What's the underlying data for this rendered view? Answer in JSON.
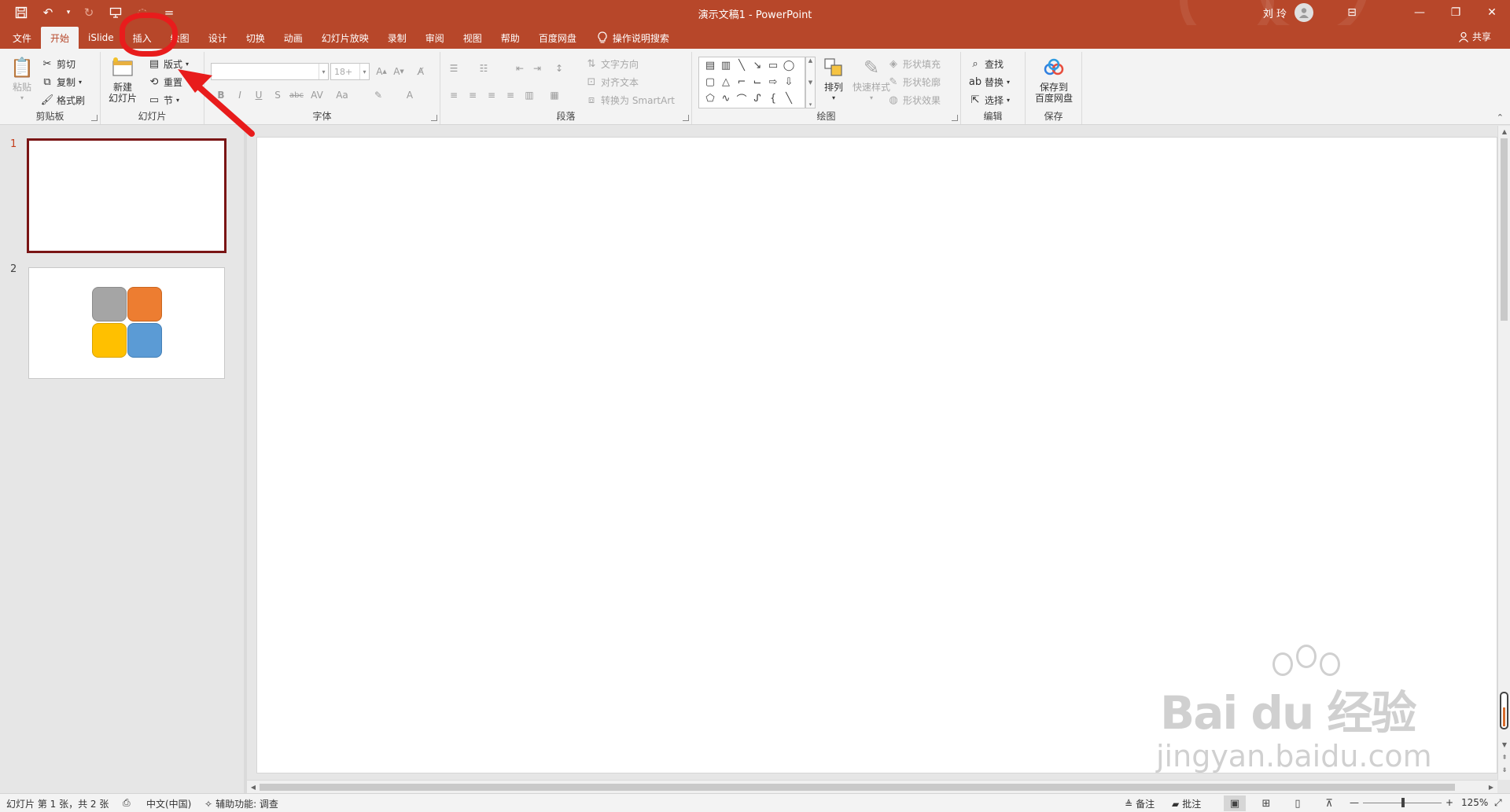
{
  "window": {
    "title": "演示文稿1  -  PowerPoint",
    "user_name": "刘 玲",
    "controls": [
      "minimize",
      "restore",
      "close"
    ]
  },
  "qat": [
    {
      "name": "save-icon",
      "glyph": "💾"
    },
    {
      "name": "undo-icon",
      "glyph": "↶"
    },
    {
      "name": "redo-icon",
      "glyph": "↻"
    },
    {
      "name": "present-icon",
      "glyph": "▭"
    },
    {
      "name": "customize-icon",
      "glyph": "="
    }
  ],
  "tabs": [
    {
      "label": "文件",
      "active": false
    },
    {
      "label": "开始",
      "active": true
    },
    {
      "label": "iSlide",
      "active": false
    },
    {
      "label": "插入",
      "active": false
    },
    {
      "label": "绘图",
      "active": false
    },
    {
      "label": "设计",
      "active": false
    },
    {
      "label": "切换",
      "active": false
    },
    {
      "label": "动画",
      "active": false
    },
    {
      "label": "幻灯片放映",
      "active": false
    },
    {
      "label": "录制",
      "active": false
    },
    {
      "label": "审阅",
      "active": false
    },
    {
      "label": "视图",
      "active": false
    },
    {
      "label": "帮助",
      "active": false
    },
    {
      "label": "百度网盘",
      "active": false
    }
  ],
  "tell_me": "操作说明搜索",
  "share": "共享",
  "ribbon": {
    "clipboard": {
      "label": "剪贴板",
      "paste": "粘贴",
      "cut": "剪切",
      "copy": "复制",
      "format_painter": "格式刷"
    },
    "slides": {
      "label": "幻灯片",
      "new_slide_line1": "新建",
      "new_slide_line2": "幻灯片",
      "layout": "版式",
      "reset": "重置",
      "section": "节"
    },
    "font": {
      "label": "字体",
      "font_name": "",
      "font_size": "18+"
    },
    "paragraph": {
      "label": "段落",
      "text_direction": "文字方向",
      "align_text": "对齐文本",
      "smartart": "转换为 SmartArt"
    },
    "drawing": {
      "label": "绘图",
      "arrange": "排列",
      "quick_styles": "快速样式",
      "shape_fill": "形状填充",
      "shape_outline": "形状轮廓",
      "shape_effects": "形状效果"
    },
    "editing": {
      "label": "编辑",
      "find": "查找",
      "replace": "替换",
      "select": "选择"
    },
    "save": {
      "label": "保存",
      "btn_line1": "保存到",
      "btn_line2": "百度网盘"
    }
  },
  "thumbnails": [
    {
      "number": "1",
      "selected": true
    },
    {
      "number": "2",
      "selected": false
    }
  ],
  "status": {
    "slide_info": "幻灯片 第 1 张，共 2 张",
    "language": "中文(中国)",
    "accessibility": "辅助功能: 调查",
    "notes": "备注",
    "comments": "批注",
    "zoom": "125%"
  },
  "watermark": {
    "logo": "Bai du 经验",
    "site": "jingyan.baidu.com"
  },
  "colors": {
    "accent": "#b7472a",
    "annotation": "#e81c1c",
    "tile_gray": "#a5a5a5",
    "tile_orange": "#ed7d31",
    "tile_yellow": "#ffc000",
    "tile_blue": "#5b9bd5"
  }
}
